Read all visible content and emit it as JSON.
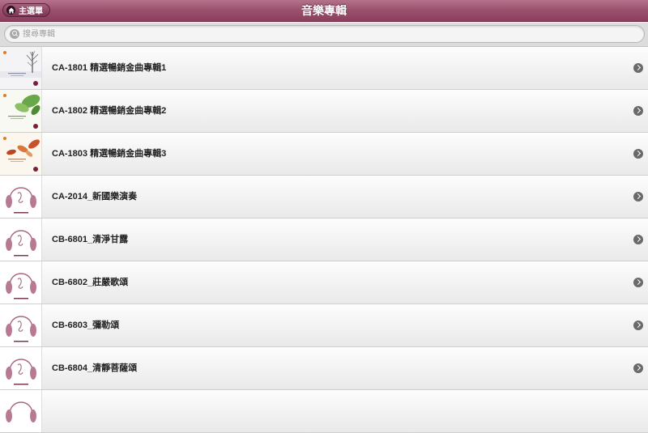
{
  "header": {
    "title": "音樂專輯",
    "home_label": "主選單"
  },
  "search": {
    "placeholder": "搜尋專輯",
    "value": ""
  },
  "list": {
    "items": [
      {
        "label": "CA-1801 精選暢銷金曲專輯1",
        "cover": "winter-tree-cover"
      },
      {
        "label": "CA-1802 精選暢銷金曲專輯2",
        "cover": "green-leaves-cover"
      },
      {
        "label": "CA-1803 精選暢銷金曲專輯3",
        "cover": "autumn-leaves-cover"
      },
      {
        "label": "CA-2014_新國樂演奏",
        "cover": "headphones-cover"
      },
      {
        "label": "CB-6801_清淨甘露",
        "cover": "headphones-cover"
      },
      {
        "label": "CB-6802_莊嚴歌頌",
        "cover": "headphones-cover"
      },
      {
        "label": "CB-6803_彌勒頌",
        "cover": "headphones-cover"
      },
      {
        "label": "CB-6804_清靜菩薩頌",
        "cover": "headphones-cover"
      },
      {
        "label": "",
        "cover": "headphones-cover"
      }
    ]
  },
  "colors": {
    "header": "#9a4f6c",
    "text": "#222222"
  }
}
